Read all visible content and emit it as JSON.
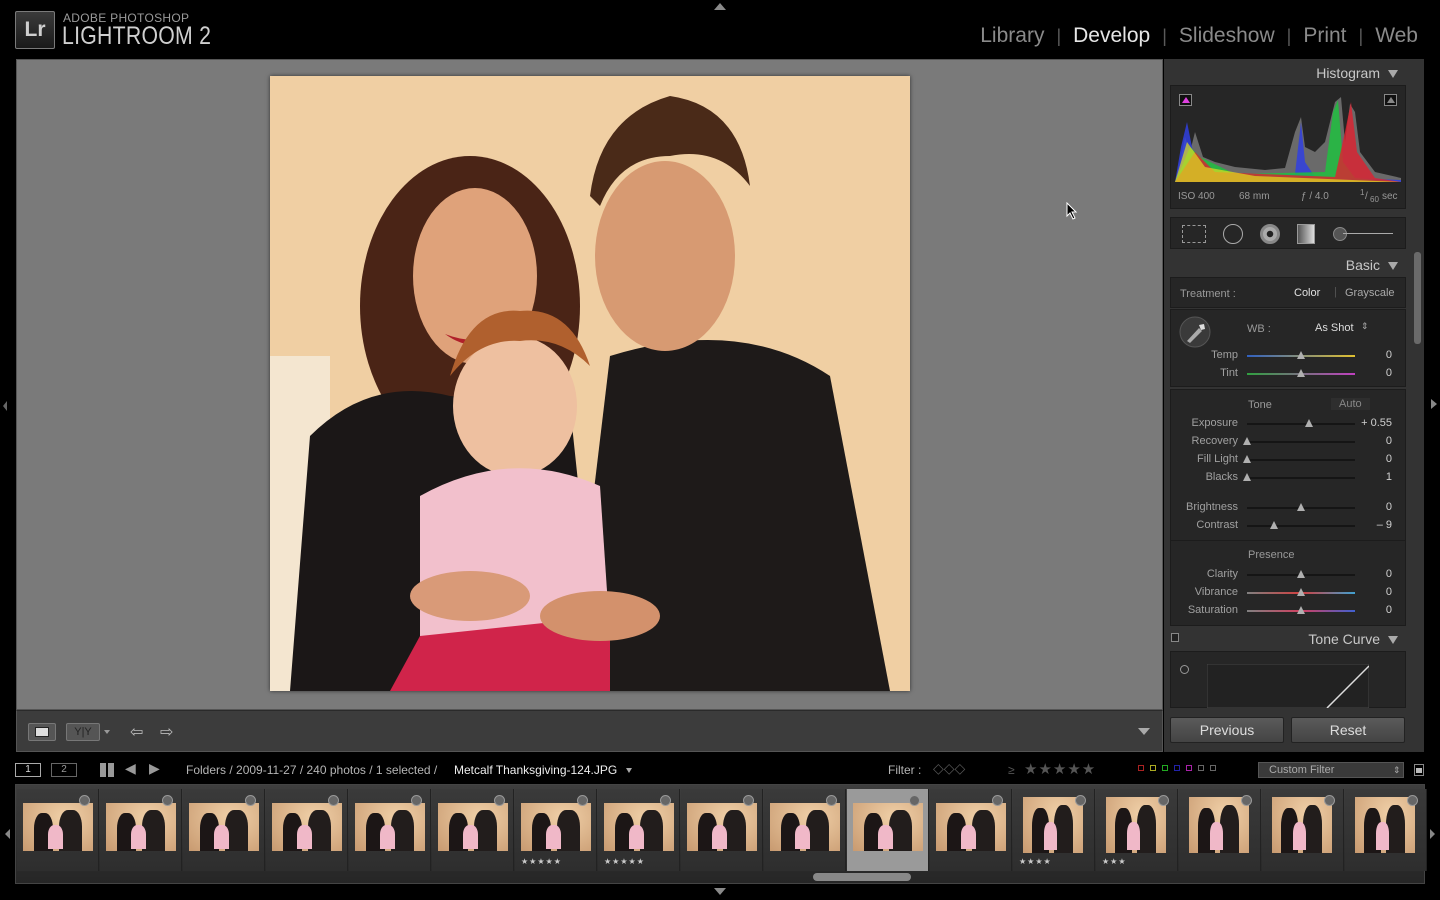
{
  "app": {
    "vendor": "ADOBE PHOTOSHOP",
    "product": "LIGHTROOM 2",
    "logo_text": "Lr"
  },
  "modules": [
    "Library",
    "Develop",
    "Slideshow",
    "Print",
    "Web"
  ],
  "active_module": "Develop",
  "right_panel": {
    "histogram": {
      "title": "Histogram",
      "iso": "ISO 400",
      "focal": "68 mm",
      "aperture": "ƒ / 4.0",
      "shutter_num": "1",
      "shutter_den": "60",
      "shutter_unit": "sec"
    },
    "basic": {
      "title": "Basic",
      "treatment_label": "Treatment :",
      "treatment_color": "Color",
      "treatment_grayscale": "Grayscale",
      "wb_label": "WB :",
      "wb_value": "As Shot",
      "tone_label": "Tone",
      "auto_label": "Auto",
      "presence_label": "Presence",
      "sliders": [
        {
          "label": "Temp",
          "value": "0",
          "pos": 0.5
        },
        {
          "label": "Tint",
          "value": "0",
          "pos": 0.5
        },
        {
          "label": "Exposure",
          "value": "+ 0.55",
          "pos": 0.57
        },
        {
          "label": "Recovery",
          "value": "0",
          "pos": 0.0
        },
        {
          "label": "Fill Light",
          "value": "0",
          "pos": 0.0
        },
        {
          "label": "Blacks",
          "value": "1",
          "pos": 0.0
        },
        {
          "label": "Brightness",
          "value": "0",
          "pos": 0.5
        },
        {
          "label": "Contrast",
          "value": "– 9",
          "pos": 0.25
        },
        {
          "label": "Clarity",
          "value": "0",
          "pos": 0.5
        },
        {
          "label": "Vibrance",
          "value": "0",
          "pos": 0.5
        },
        {
          "label": "Saturation",
          "value": "0",
          "pos": 0.5
        }
      ]
    },
    "tone_curve": {
      "title": "Tone Curve"
    },
    "previous_button": "Previous",
    "reset_button": "Reset"
  },
  "navbar": {
    "view1": "1",
    "view2": "2",
    "path": "Folders / 2009-11-27 / 240 photos / 1 selected /",
    "filename": "Metcalf Thanksgiving-124.JPG",
    "filter_label": "Filter :",
    "filter_value": "Custom Filter",
    "gte": "≥"
  },
  "filmstrip": {
    "selected_index": 10,
    "thumbs": [
      {
        "stars": ""
      },
      {
        "stars": ""
      },
      {
        "stars": ""
      },
      {
        "stars": ""
      },
      {
        "stars": ""
      },
      {
        "stars": ""
      },
      {
        "stars": "★★★★★"
      },
      {
        "stars": "★★★★★"
      },
      {
        "stars": ""
      },
      {
        "stars": ""
      },
      {
        "stars": ""
      },
      {
        "stars": ""
      },
      {
        "stars": "★★★★"
      },
      {
        "stars": "★★★"
      },
      {
        "stars": ""
      },
      {
        "stars": ""
      },
      {
        "stars": ""
      }
    ]
  },
  "colors": {
    "accent_active": "#e6e6e6",
    "panel_bg": "#333333",
    "workspace_bg": "#7a7a7a"
  }
}
